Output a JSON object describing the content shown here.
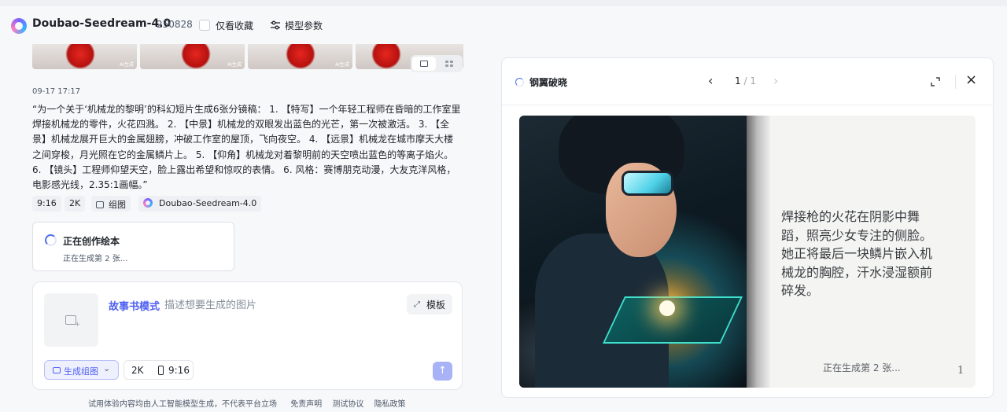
{
  "header": {
    "model_name": "Doubao-Seedream-4.0",
    "model_version": "250828",
    "favorites_label": "仅看收藏",
    "params_label": "模型参数"
  },
  "gallery": {
    "thumbnails": [
      {
        "badge": "AI生成"
      },
      {
        "badge": "AI生成"
      },
      {
        "badge": "AI生成"
      },
      {
        "badge": ""
      }
    ]
  },
  "message": {
    "timestamp": "09-17 17:17",
    "prompt": "“为一个关于‘机械龙的黎明’的科幻短片生成6张分镜稿： 1. 【特写】一个年轻工程师在昏暗的工作室里焊接机械龙的零件，火花四溅。 2. 【中景】机械龙的双眼发出蓝色的光芒，第一次被激活。 3. 【全景】机械龙展开巨大的金属翅膀，冲破工作室的屋顶，飞向夜空。 4. 【远景】机械龙在城市摩天大楼之间穿梭，月光照在它的金属鳞片上。 5. 【仰角】机械龙对着黎明前的天空喷出蓝色的等离子焰火。 6. 【镜头】工程师仰望天空，脸上露出希望和惊叹的表情。 6. 风格：赛博朋克动漫，大友克洋风格，电影感光线，2.35:1画幅。”",
    "tags": {
      "ratio": "9:16",
      "resolution": "2K",
      "mode": "组图",
      "model": "Doubao-Seedream-4.0"
    }
  },
  "status_card": {
    "title": "正在创作绘本",
    "subtitle": "正在生成第 2 张..."
  },
  "composer": {
    "mode_label": "故事书模式",
    "placeholder": "描述想要生成的图片",
    "template_label": "模板",
    "generate_label": "生成组图",
    "resolution": "2K",
    "ratio": "9:16",
    "send_icon": "arrow-up-icon"
  },
  "footer": {
    "disclaimer": "试用体验内容均由人工智能模型生成，不代表平台立场",
    "links": [
      "免责声明",
      "测试协议",
      "隐私政策"
    ]
  },
  "book_panel": {
    "title": "钢翼破晓",
    "current_page": "1",
    "total_pages": "/ 1",
    "story_text": "焊接枪的火花在阴影中舞蹈，照亮少女专注的侧脸。她正将最后一块鳞片嵌入机械龙的胸腔，汗水浸湿额前碎发。",
    "generating_text": "正在生成第 2 张...",
    "page_number": "1"
  },
  "colors": {
    "accent": "#4e5ff2",
    "send_disabled": "#a8b2f6",
    "panel_border": "#e5e6eb"
  }
}
